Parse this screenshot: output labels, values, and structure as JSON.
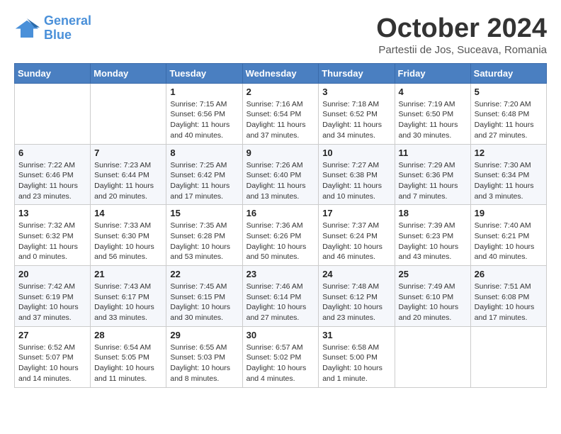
{
  "header": {
    "logo_line1": "General",
    "logo_line2": "Blue",
    "month_title": "October 2024",
    "subtitle": "Partestii de Jos, Suceava, Romania"
  },
  "weekdays": [
    "Sunday",
    "Monday",
    "Tuesday",
    "Wednesday",
    "Thursday",
    "Friday",
    "Saturday"
  ],
  "weeks": [
    [
      {
        "day": "",
        "info": ""
      },
      {
        "day": "",
        "info": ""
      },
      {
        "day": "1",
        "info": "Sunrise: 7:15 AM\nSunset: 6:56 PM\nDaylight: 11 hours and 40 minutes."
      },
      {
        "day": "2",
        "info": "Sunrise: 7:16 AM\nSunset: 6:54 PM\nDaylight: 11 hours and 37 minutes."
      },
      {
        "day": "3",
        "info": "Sunrise: 7:18 AM\nSunset: 6:52 PM\nDaylight: 11 hours and 34 minutes."
      },
      {
        "day": "4",
        "info": "Sunrise: 7:19 AM\nSunset: 6:50 PM\nDaylight: 11 hours and 30 minutes."
      },
      {
        "day": "5",
        "info": "Sunrise: 7:20 AM\nSunset: 6:48 PM\nDaylight: 11 hours and 27 minutes."
      }
    ],
    [
      {
        "day": "6",
        "info": "Sunrise: 7:22 AM\nSunset: 6:46 PM\nDaylight: 11 hours and 23 minutes."
      },
      {
        "day": "7",
        "info": "Sunrise: 7:23 AM\nSunset: 6:44 PM\nDaylight: 11 hours and 20 minutes."
      },
      {
        "day": "8",
        "info": "Sunrise: 7:25 AM\nSunset: 6:42 PM\nDaylight: 11 hours and 17 minutes."
      },
      {
        "day": "9",
        "info": "Sunrise: 7:26 AM\nSunset: 6:40 PM\nDaylight: 11 hours and 13 minutes."
      },
      {
        "day": "10",
        "info": "Sunrise: 7:27 AM\nSunset: 6:38 PM\nDaylight: 11 hours and 10 minutes."
      },
      {
        "day": "11",
        "info": "Sunrise: 7:29 AM\nSunset: 6:36 PM\nDaylight: 11 hours and 7 minutes."
      },
      {
        "day": "12",
        "info": "Sunrise: 7:30 AM\nSunset: 6:34 PM\nDaylight: 11 hours and 3 minutes."
      }
    ],
    [
      {
        "day": "13",
        "info": "Sunrise: 7:32 AM\nSunset: 6:32 PM\nDaylight: 11 hours and 0 minutes."
      },
      {
        "day": "14",
        "info": "Sunrise: 7:33 AM\nSunset: 6:30 PM\nDaylight: 10 hours and 56 minutes."
      },
      {
        "day": "15",
        "info": "Sunrise: 7:35 AM\nSunset: 6:28 PM\nDaylight: 10 hours and 53 minutes."
      },
      {
        "day": "16",
        "info": "Sunrise: 7:36 AM\nSunset: 6:26 PM\nDaylight: 10 hours and 50 minutes."
      },
      {
        "day": "17",
        "info": "Sunrise: 7:37 AM\nSunset: 6:24 PM\nDaylight: 10 hours and 46 minutes."
      },
      {
        "day": "18",
        "info": "Sunrise: 7:39 AM\nSunset: 6:23 PM\nDaylight: 10 hours and 43 minutes."
      },
      {
        "day": "19",
        "info": "Sunrise: 7:40 AM\nSunset: 6:21 PM\nDaylight: 10 hours and 40 minutes."
      }
    ],
    [
      {
        "day": "20",
        "info": "Sunrise: 7:42 AM\nSunset: 6:19 PM\nDaylight: 10 hours and 37 minutes."
      },
      {
        "day": "21",
        "info": "Sunrise: 7:43 AM\nSunset: 6:17 PM\nDaylight: 10 hours and 33 minutes."
      },
      {
        "day": "22",
        "info": "Sunrise: 7:45 AM\nSunset: 6:15 PM\nDaylight: 10 hours and 30 minutes."
      },
      {
        "day": "23",
        "info": "Sunrise: 7:46 AM\nSunset: 6:14 PM\nDaylight: 10 hours and 27 minutes."
      },
      {
        "day": "24",
        "info": "Sunrise: 7:48 AM\nSunset: 6:12 PM\nDaylight: 10 hours and 23 minutes."
      },
      {
        "day": "25",
        "info": "Sunrise: 7:49 AM\nSunset: 6:10 PM\nDaylight: 10 hours and 20 minutes."
      },
      {
        "day": "26",
        "info": "Sunrise: 7:51 AM\nSunset: 6:08 PM\nDaylight: 10 hours and 17 minutes."
      }
    ],
    [
      {
        "day": "27",
        "info": "Sunrise: 6:52 AM\nSunset: 5:07 PM\nDaylight: 10 hours and 14 minutes."
      },
      {
        "day": "28",
        "info": "Sunrise: 6:54 AM\nSunset: 5:05 PM\nDaylight: 10 hours and 11 minutes."
      },
      {
        "day": "29",
        "info": "Sunrise: 6:55 AM\nSunset: 5:03 PM\nDaylight: 10 hours and 8 minutes."
      },
      {
        "day": "30",
        "info": "Sunrise: 6:57 AM\nSunset: 5:02 PM\nDaylight: 10 hours and 4 minutes."
      },
      {
        "day": "31",
        "info": "Sunrise: 6:58 AM\nSunset: 5:00 PM\nDaylight: 10 hours and 1 minute."
      },
      {
        "day": "",
        "info": ""
      },
      {
        "day": "",
        "info": ""
      }
    ]
  ]
}
